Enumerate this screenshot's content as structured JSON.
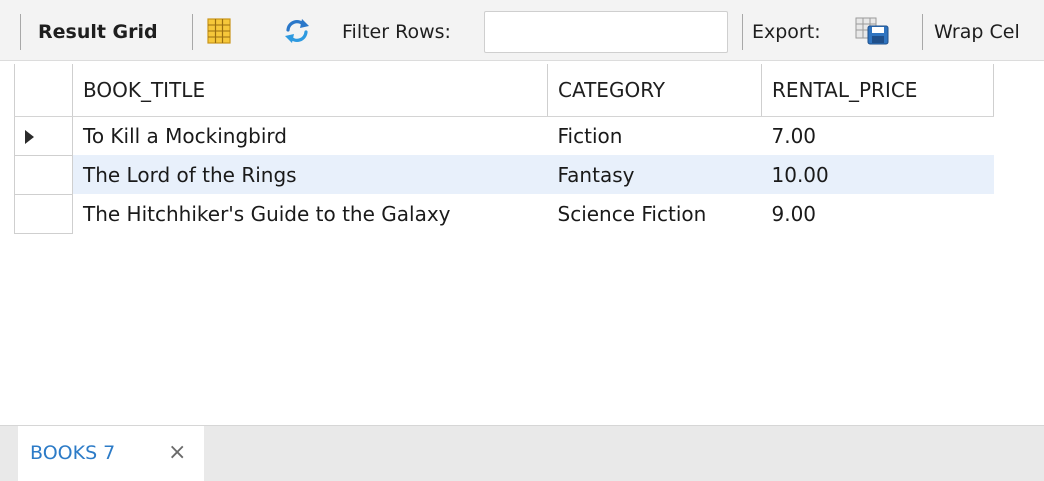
{
  "toolbar": {
    "result_grid_label": "Result Grid",
    "filter_rows_label": "Filter Rows:",
    "filter_value": "",
    "export_label": "Export:",
    "wrap_cell_label": "Wrap Cel"
  },
  "grid": {
    "columns": [
      "BOOK_TITLE",
      "CATEGORY",
      "RENTAL_PRICE"
    ],
    "rows": [
      [
        "To Kill a Mockingbird",
        "Fiction",
        "7.00"
      ],
      [
        "The Lord of the Rings",
        "Fantasy",
        "10.00"
      ],
      [
        "The Hitchhiker's Guide to the Galaxy",
        "Science Fiction",
        "9.00"
      ]
    ],
    "selected_row": 0,
    "highlighted_row": 1
  },
  "tabs": [
    {
      "label": "BOOKS 7",
      "close": "×"
    }
  ],
  "colors": {
    "tab_text": "#2c7bc7",
    "highlight_row": "#e8f0fb",
    "toolbar_bg": "#f3f3f3"
  },
  "icons": [
    "grid-layout-icon",
    "refresh-icon",
    "export-save-icon",
    "row-cursor-icon",
    "close-icon"
  ]
}
